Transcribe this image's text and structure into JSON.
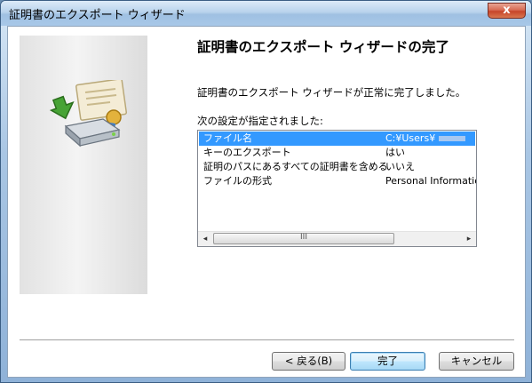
{
  "window": {
    "title": "証明書のエクスポート ウィザード",
    "close_label": "x"
  },
  "icons": {
    "wizard": "certificate-export-icon",
    "close": "close-icon"
  },
  "content": {
    "heading": "証明書のエクスポート ウィザードの完了",
    "message": "証明書のエクスポート ウィザードが正常に完了しました。",
    "list_label": "次の設定が指定されました:"
  },
  "settings": [
    {
      "name": "ファイル名",
      "value": "C:¥Users¥"
    },
    {
      "name": "キーのエクスポート",
      "value": "はい"
    },
    {
      "name": "証明のパスにあるすべての証明書を含める",
      "value": "いいえ"
    },
    {
      "name": "ファイルの形式",
      "value": "Personal Information"
    }
  ],
  "scrollbar": {
    "left": "◂",
    "right": "▸",
    "grip": "III"
  },
  "buttons": {
    "back": "< 戻る(B)",
    "finish": "完了",
    "cancel": "キャンセル"
  },
  "colors": {
    "selection": "#3399ff",
    "close_button": "#c7452a",
    "default_button_border": "#3c7fb1"
  }
}
